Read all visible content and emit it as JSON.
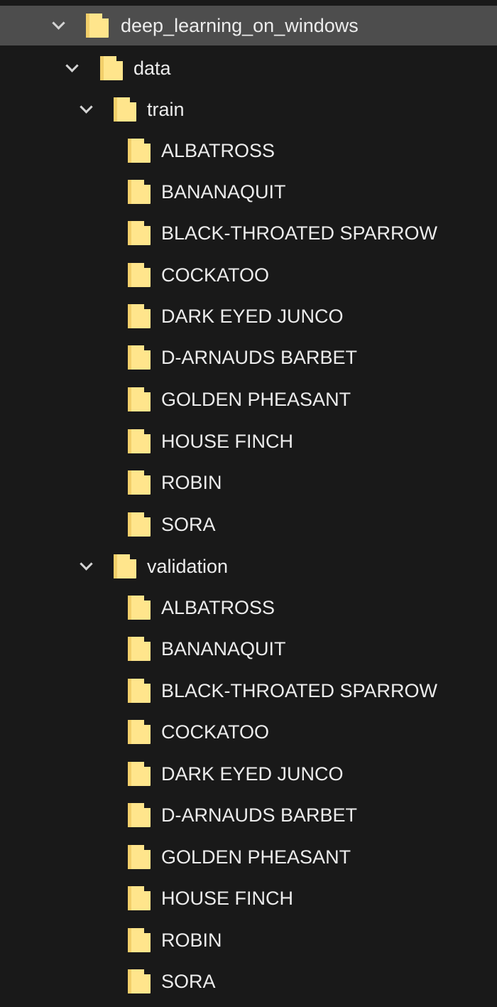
{
  "tree": {
    "root": {
      "label": "deep_learning_on_windows",
      "icon": "folder-open-icon",
      "expanded": true
    },
    "data": {
      "label": "data",
      "expanded": true
    },
    "train": {
      "label": "train",
      "expanded": true,
      "children": [
        "ALBATROSS",
        "BANANAQUIT",
        "BLACK-THROATED SPARROW",
        "COCKATOO",
        "DARK EYED JUNCO",
        "D-ARNAUDS BARBET",
        "GOLDEN PHEASANT",
        "HOUSE FINCH",
        "ROBIN",
        "SORA"
      ]
    },
    "validation": {
      "label": "validation",
      "expanded": true,
      "children": [
        "ALBATROSS",
        "BANANAQUIT",
        "BLACK-THROATED SPARROW",
        "COCKATOO",
        "DARK EYED JUNCO",
        "D-ARNAUDS BARBET",
        "GOLDEN PHEASANT",
        "HOUSE FINCH",
        "ROBIN",
        "SORA"
      ]
    }
  },
  "colors": {
    "background": "#191919",
    "selected_row": "#4d4d4d",
    "folder": "#ffe58c",
    "text": "#ececec"
  }
}
